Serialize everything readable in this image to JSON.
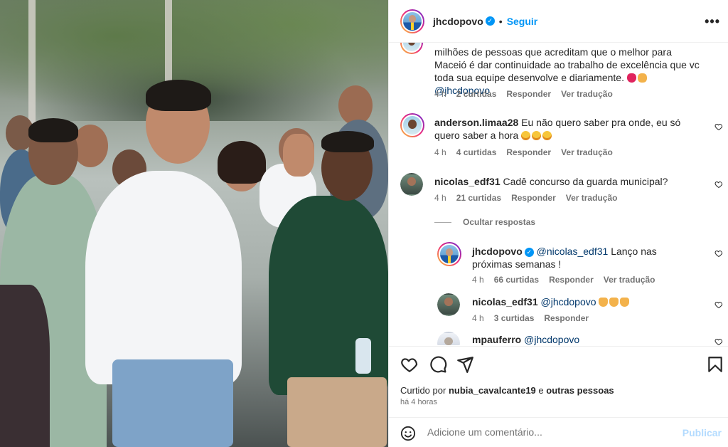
{
  "post": {
    "author": "jhcdopovo",
    "follow_label": "Seguir",
    "more_label": "•••",
    "photo_alt_icon": "photo-image"
  },
  "comments": [
    {
      "user": "",
      "text_before": "milhões de pessoas que acreditam que o melhor para Maceió é dar continuidade ao trabalho de excelência que vc toda sua equipe desenvolve e diariamente.",
      "mention": "@jhcdopovo",
      "time": "4 h",
      "likes": "2 curtidas",
      "reply": "Responder",
      "translate": "Ver tradução"
    },
    {
      "user": "anderson.limaa28",
      "text": "Eu não quero saber pra onde, eu só quero saber a hora",
      "time": "4 h",
      "likes": "4 curtidas",
      "reply": "Responder",
      "translate": "Ver tradução"
    },
    {
      "user": "nicolas_edf31",
      "text": "Cadê concurso da guarda municipal?",
      "time": "4 h",
      "likes": "21 curtidas",
      "reply": "Responder",
      "translate": "Ver tradução"
    }
  ],
  "hide_replies": "Ocultar respostas",
  "replies": [
    {
      "user": "jhcdopovo",
      "mention": "@nicolas_edf31",
      "text": "Lanço nas próximas semanas !",
      "time": "4 h",
      "likes": "66 curtidas",
      "reply": "Responder",
      "translate": "Ver tradução"
    },
    {
      "user": "nicolas_edf31",
      "mention": "@jhcdopovo",
      "time": "4 h",
      "likes": "3 curtidas",
      "reply": "Responder"
    },
    {
      "user": "mpauferro",
      "mention": "@jhcdopovo"
    }
  ],
  "likes_summary": {
    "prefix": "Curtido por",
    "user": "nubia_cavalcante19",
    "conj": "e",
    "others": "outras pessoas"
  },
  "posted_time": "há 4 horas",
  "add_comment": {
    "placeholder": "Adicione um comentário...",
    "publish_label": "Publicar"
  },
  "colors": {
    "accent": "#0095f6",
    "publish_disabled": "#b3dbff",
    "muted": "#737373"
  }
}
